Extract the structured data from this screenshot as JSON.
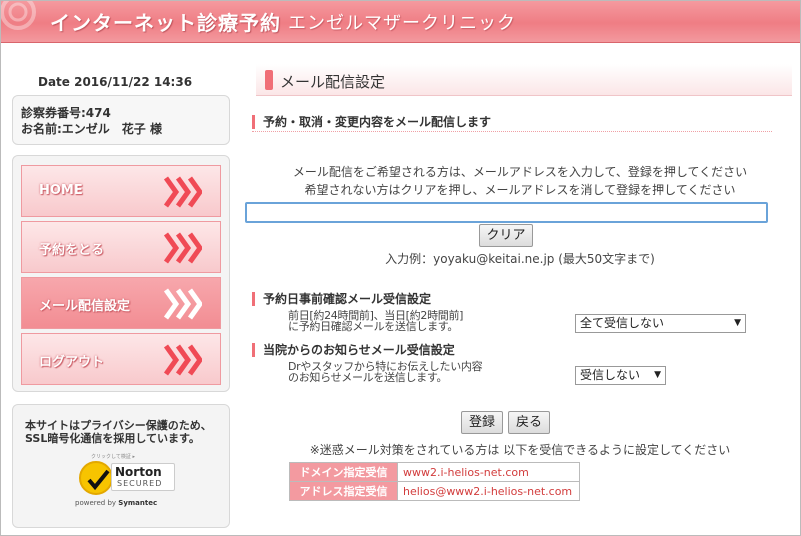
{
  "header": {
    "title": "インターネット診療予約",
    "clinic": "エンゼルマザークリニック"
  },
  "sidebar": {
    "date": "Date 2016/11/22 14:36",
    "patient_no": "診察券番号:474",
    "patient_name": "お名前:エンゼル　花子 様",
    "nav": [
      {
        "label": "HOME"
      },
      {
        "label": "予約をとる"
      },
      {
        "label": "メール配信設定"
      },
      {
        "label": "ログアウト"
      }
    ],
    "privacy_text": "本サイトはプライバシー保護のため、SSL暗号化通信を採用しています。",
    "norton": {
      "tiny": "クリックして検証 ▸",
      "name": "Norton",
      "secured": "SECURED",
      "powered": "powered by",
      "symantec": "Symantec"
    }
  },
  "main": {
    "title": "メール配信設定",
    "section1": "予約・取消・変更内容をメール配信します",
    "desc1": "メール配信をご希望される方は、メールアドレスを入力して、登録を押してください",
    "desc2": "希望されない方はクリアを押し、メールアドレスを消して登録を押してください",
    "email_value": "",
    "clear_label": "クリア",
    "example": "入力例：yoyaku@keitai.ne.jp (最大50文字まで)",
    "section2": "予約日事前確認メール受信設定",
    "section2_note1": "前日[約24時間前]、当日[約2時間前]",
    "section2_note2": "に予約日確認メールを送信します。",
    "section2_select": "全て受信しない",
    "section3": "当院からのお知らせメール受信設定",
    "section3_note1": "Drやスタッフから特にお伝えしたい内容",
    "section3_note2": "のお知らせメールを送信します。",
    "section3_select": "受信しない",
    "register_label": "登録",
    "back_label": "戻る",
    "warning": "※迷惑メール対策をされている方は 以下を受信できるように設定してください",
    "domain_key": "ドメイン指定受信",
    "domain_value": "www2.i-helios-net.com",
    "address_key": "アドレス指定受信",
    "address_value": "helios@www2.i-helios-net.com"
  }
}
